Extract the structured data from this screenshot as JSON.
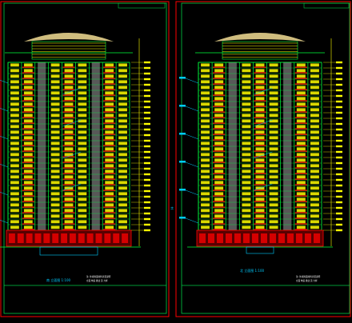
{
  "canvas": {
    "background": "#000000",
    "frame_color": "#ff0000",
    "border_color": "#00cc44"
  },
  "drawing_colors": {
    "facade": "#00ff3c",
    "windows": "#ffff00",
    "balconies": "#ff0000",
    "columns": "#a0a0a0",
    "annotations": "#00ccff",
    "roof": "#e6d28c"
  },
  "sheets": [
    {
      "id": "left",
      "title": "南 立面图 1:100",
      "note_lines": [
        "注: 外墙饰面材料详见说明",
        "立面 构造 做法 见 大样"
      ],
      "floor_count": 30
    },
    {
      "id": "right",
      "title": "北 立面图 1:100",
      "note_lines": [
        "注: 外墙饰面材料详见说明",
        "立面 构造 做法 见 大样"
      ],
      "floor_count": 30
    }
  ],
  "center_mark": "±"
}
